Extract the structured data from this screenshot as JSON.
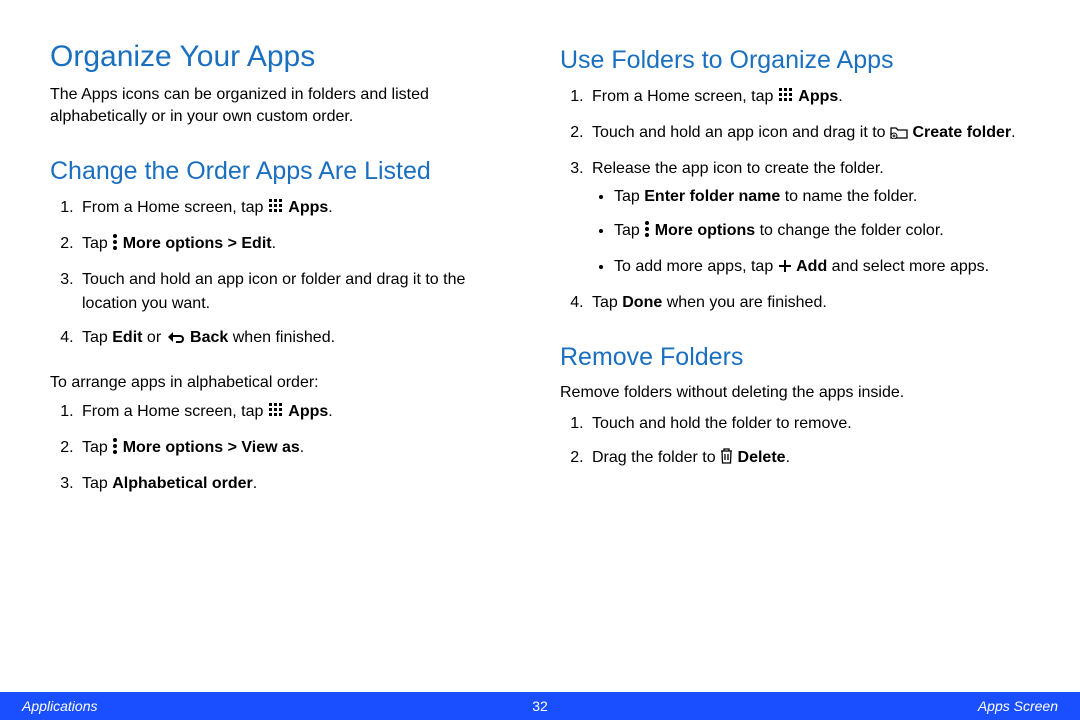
{
  "left": {
    "h1": "Organize Your Apps",
    "intro": "The Apps icons can be organized in folders and listed alphabetically or in your own custom order.",
    "h2a": "Change the Order Apps Are Listed",
    "s1_pre": "From a Home screen, tap ",
    "s1_bold": "Apps",
    "s1_post": ".",
    "s2_pre": "Tap ",
    "s2_bold": "More options > Edit",
    "s2_post": ".",
    "s3": "Touch and hold an app icon or folder and drag it to the location you want.",
    "s4_pre": "Tap ",
    "s4_b1": "Edit",
    "s4_mid": " or ",
    "s4_b2": "Back",
    "s4_post": " when finished.",
    "alpha_intro": "To arrange apps in alphabetical order:",
    "a1_pre": "From a Home screen, tap ",
    "a1_bold": "Apps",
    "a1_post": ".",
    "a2_pre": "Tap ",
    "a2_bold": "More options > View as",
    "a2_post": ".",
    "a3_pre": "Tap ",
    "a3_bold": "Alphabetical order",
    "a3_post": "."
  },
  "right": {
    "h2a": "Use Folders to Organize Apps",
    "r1_pre": "From a Home screen, tap ",
    "r1_bold": "Apps",
    "r1_post": ".",
    "r2_pre": "Touch and hold an app icon and drag it to ",
    "r2_bold": "Create folder",
    "r2_post": ".",
    "r3": "Release the app icon to create the folder.",
    "b1_pre": "Tap ",
    "b1_bold": "Enter folder name",
    "b1_post": " to name the folder.",
    "b2_pre": "Tap ",
    "b2_bold": "More options",
    "b2_post": " to change the folder color.",
    "b3_pre": "To add more apps, tap ",
    "b3_bold": "Add",
    "b3_post": " and select more apps.",
    "r4_pre": "Tap ",
    "r4_bold": "Done",
    "r4_post": " when you are finished.",
    "h2b": "Remove Folders",
    "rem_intro": "Remove folders without deleting the apps inside.",
    "d1": "Touch and hold the folder to remove.",
    "d2_pre": "Drag the folder to ",
    "d2_bold": "Delete",
    "d2_post": "."
  },
  "footer": {
    "left": "Applications",
    "center": "32",
    "right": "Apps Screen"
  }
}
